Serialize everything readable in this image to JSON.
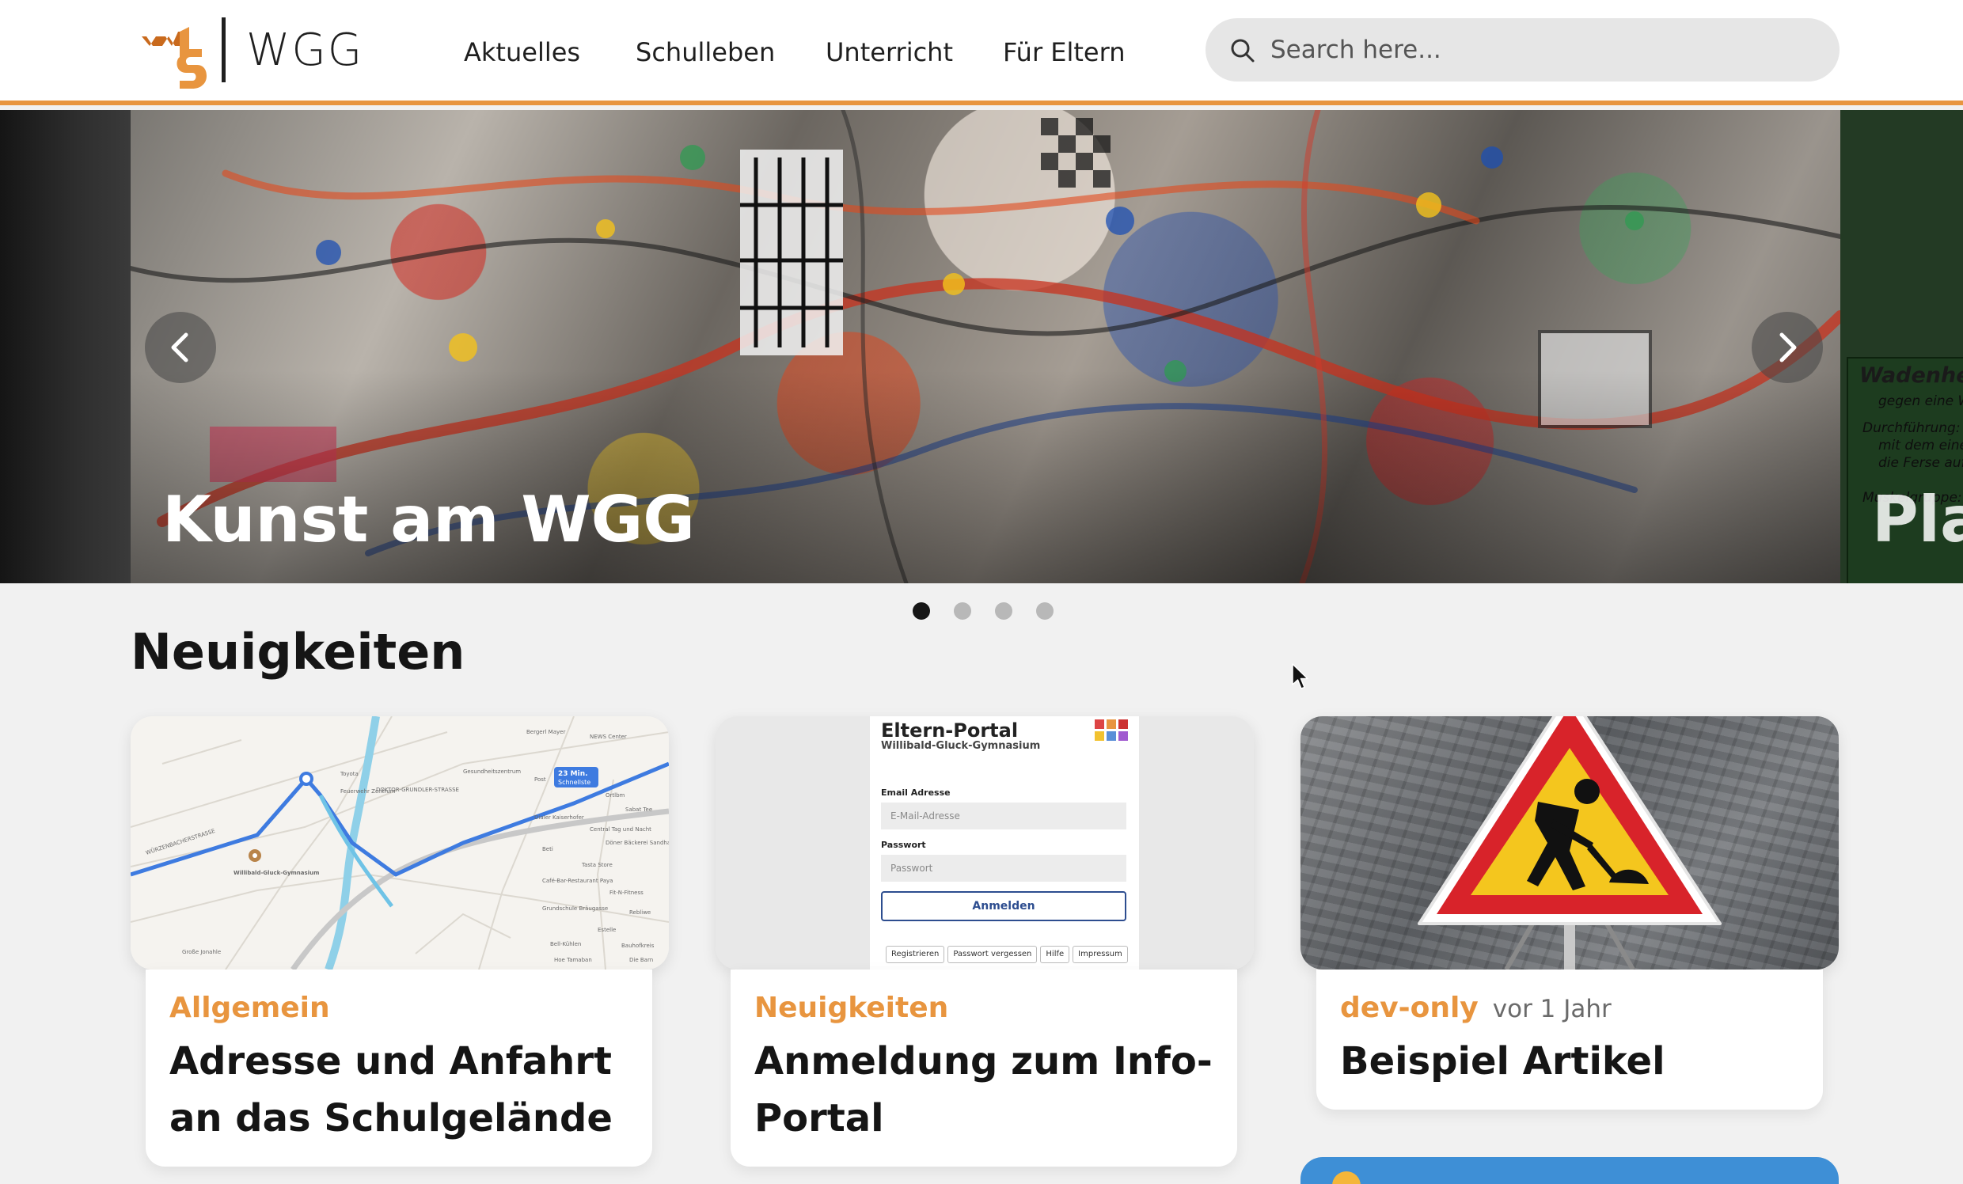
{
  "header": {
    "logo_text": "WGG",
    "nav": [
      {
        "label": "Aktuelles"
      },
      {
        "label": "Schulleben"
      },
      {
        "label": "Unterricht"
      },
      {
        "label": "Für Eltern"
      }
    ],
    "search": {
      "placeholder": "Search here...",
      "icon": "search-icon"
    }
  },
  "carousel": {
    "current_title": "Kunst am WGG",
    "next_title_partial": "Pla",
    "next_poster": {
      "heading": "Wadenheb",
      "line1": "gegen eine W",
      "line2": "Durchführung:",
      "line3": "mit dem einen",
      "line4": "die Ferse auf d",
      "line5": "Muskelgruppe:"
    },
    "prev_icon": "chevron-left-icon",
    "next_icon": "chevron-right-icon",
    "dots": 4,
    "active_dot": 1
  },
  "news": {
    "title": "Neuigkeiten",
    "cards": [
      {
        "category": "Allgemein",
        "time": "",
        "title": "Adresse und Anfahrt an das Schulgelände",
        "image": "map-image",
        "map": {
          "school_label": "Willibald-Gluck-Gymnasium",
          "route_badge_line1": "23 Min.",
          "route_badge_line2": "Schnellste",
          "street1": "WÜRZENBACHERSTRASSE",
          "street2": "DOKTOR-GRUNDLER-STRASSE",
          "poi1": "Toyota",
          "poi2": "Feuerwehr Zentrum",
          "poi3": "Gesundheitszentrum",
          "poi4": "Post",
          "poi5": "Ortlbm",
          "poi6": "Sabat Tee",
          "poi7": "Dialer Kaiserhofer",
          "poi8": "Central Tag und Nacht",
          "poi9": "Döner Bäckerei Sandham Café",
          "poi10": "Beti",
          "poi11": "Tasta Store",
          "poi12": "Café-Bar-Restaurant Paya",
          "poi13": "Grundschule Bräugasse",
          "poi14": "Fit-N-Fitness",
          "poi15": "Rebliwe",
          "poi16": "Estelle",
          "poi17": "Bell-Kühlen",
          "poi18": "Bauhofkreis",
          "poi19": "Hoe Tamaban",
          "poi20": "Die Barn",
          "poi21": "Große Jonahle",
          "poi22": "Bergerl Mayer",
          "poi23": "NEWS Center"
        }
      },
      {
        "category": "Neuigkeiten",
        "time": "",
        "title": "Anmeldung zum Info-Portal",
        "image": "portal-screenshot",
        "portal": {
          "heading": "Eltern-Portal",
          "subheading": "Willibald-Gluck-Gymnasium",
          "email_label": "Email Adresse",
          "email_placeholder": "E-Mail-Adresse",
          "password_label": "Passwort",
          "password_placeholder": "Passwort",
          "login_button": "Anmelden",
          "links": [
            "Registrieren",
            "Passwort vergessen",
            "Hilfe",
            "Impressum"
          ]
        }
      },
      {
        "category": "dev-only",
        "time": "vor 1 Jahr",
        "title": "Beispiel Artikel",
        "image": "construction-sign-image"
      }
    ]
  },
  "colors": {
    "accent": "#e8953f",
    "text": "#151515",
    "background": "#f1f1f1",
    "dot_active": "#161616",
    "dot_inactive": "#b8b8b8"
  }
}
